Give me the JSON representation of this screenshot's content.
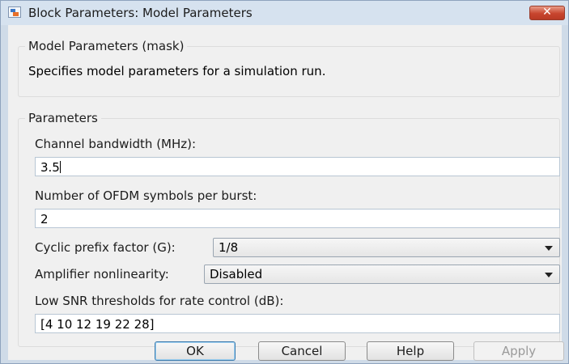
{
  "window": {
    "title": "Block Parameters: Model Parameters",
    "close_glyph": "✕"
  },
  "mask_group": {
    "legend": "Model Parameters (mask)",
    "description": "Specifies model parameters for a simulation run."
  },
  "params_group": {
    "legend": "Parameters",
    "channel_bandwidth": {
      "label": "Channel bandwidth (MHz):",
      "value": "3.5"
    },
    "ofdm_symbols": {
      "label": "Number of OFDM symbols per burst:",
      "value": "2"
    },
    "cyclic_prefix": {
      "label": "Cyclic prefix factor (G):",
      "value": "1/8"
    },
    "amplifier": {
      "label": "Amplifier nonlinearity:",
      "value": "Disabled"
    },
    "snr_thresholds": {
      "label": "Low SNR thresholds for rate control (dB):",
      "value": "[4 10 12 19 22 28]"
    }
  },
  "buttons": {
    "ok": "OK",
    "cancel": "Cancel",
    "help": "Help",
    "apply": "Apply"
  },
  "icons": {
    "window_icon": "block-parameters-icon",
    "close_icon": "close-icon",
    "dropdown_icon": "chevron-down-icon"
  },
  "colors": {
    "titlebar": "#d6e2ef",
    "close_button": "#c8452e",
    "dialog_background": "#f0f0f0"
  }
}
